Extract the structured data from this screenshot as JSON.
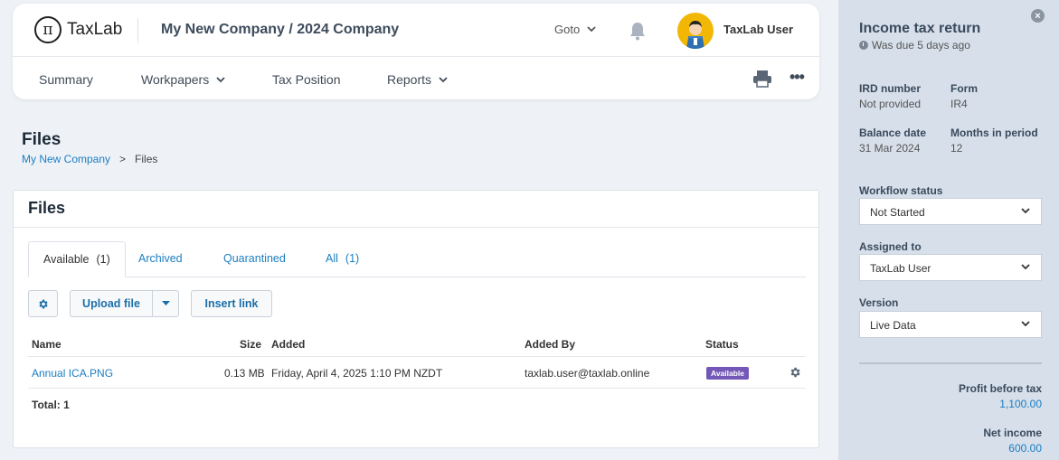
{
  "header": {
    "logo_text": "TaxLab",
    "logo_symbol": "π",
    "company": "My New Company / 2024 Company",
    "goto_label": "Goto",
    "user_name": "TaxLab User"
  },
  "nav": {
    "items": [
      {
        "label": "Summary"
      },
      {
        "label": "Workpapers"
      },
      {
        "label": "Tax Position"
      },
      {
        "label": "Reports"
      }
    ],
    "more": "•••"
  },
  "page": {
    "title": "Files",
    "breadcrumb": {
      "root": "My New Company",
      "separator": ">",
      "current": "Files"
    }
  },
  "files_panel": {
    "title": "Files",
    "tabs": [
      {
        "label": "Available",
        "count": "(1)"
      },
      {
        "label": "Archived",
        "count": ""
      },
      {
        "label": "Quarantined",
        "count": ""
      },
      {
        "label": "All",
        "count": "(1)"
      }
    ],
    "buttons": {
      "upload": "Upload file",
      "insert_link": "Insert link"
    },
    "columns": [
      "Name",
      "Size",
      "Added",
      "Added By",
      "Status"
    ],
    "rows": [
      {
        "name": "Annual ICA.PNG",
        "size": "0.13 MB",
        "added": "Friday, April 4, 2025 1:10 PM NZDT",
        "added_by": "taxlab.user@taxlab.online",
        "status": "Available"
      }
    ],
    "total": "Total: 1"
  },
  "sidebar": {
    "close": "×",
    "title": "Income tax return",
    "due": "Was due 5 days ago",
    "fields": {
      "ird_label": "IRD number",
      "ird_value": "Not provided",
      "form_label": "Form",
      "form_value": "IR4",
      "balance_label": "Balance date",
      "balance_value": "31 Mar 2024",
      "months_label": "Months in period",
      "months_value": "12"
    },
    "workflow": {
      "label": "Workflow status",
      "value": "Not Started"
    },
    "assigned": {
      "label": "Assigned to",
      "value": "TaxLab User"
    },
    "version": {
      "label": "Version",
      "value": "Live Data"
    },
    "summary": {
      "profit_label": "Profit before tax",
      "profit_value": "1,100.00",
      "net_label": "Net income",
      "net_value": "600.00"
    }
  },
  "colors": {
    "accent": "#1b7ec2",
    "badge": "#7358b7",
    "avatar_bg": "#f2b705",
    "sidebar_bg": "#d6dfea"
  }
}
